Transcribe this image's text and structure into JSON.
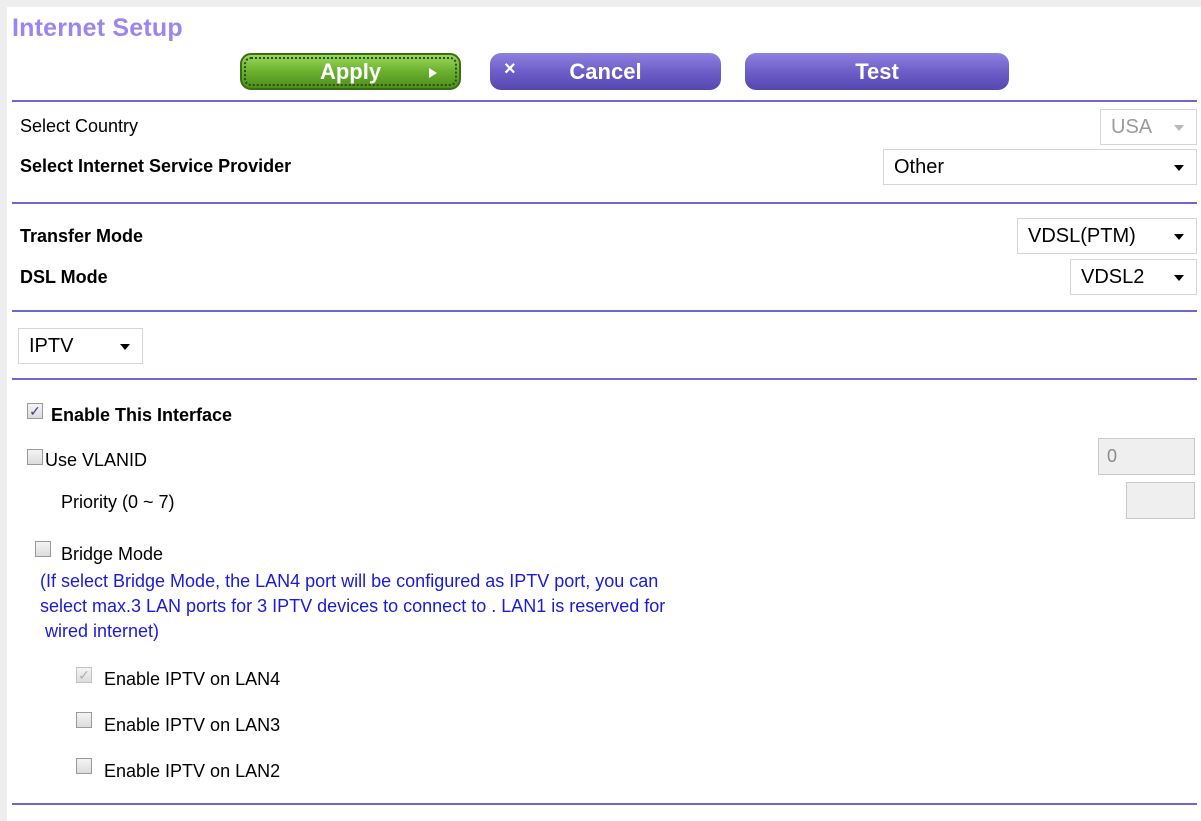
{
  "page": {
    "title": "Internet Setup"
  },
  "toolbar": {
    "apply_label": "Apply",
    "cancel_label": "Cancel",
    "cancel_icon": "×",
    "test_label": "Test"
  },
  "country": {
    "label": "Select Country",
    "value": "USA",
    "disabled": true
  },
  "isp": {
    "label": "Select Internet Service Provider",
    "value": "Other"
  },
  "transfer_mode": {
    "label": "Transfer Mode",
    "value": "VDSL(PTM)"
  },
  "dsl_mode": {
    "label": "DSL Mode",
    "value": "VDSL2"
  },
  "service": {
    "value": "IPTV"
  },
  "interface": {
    "enable_label": "Enable This Interface",
    "enable_checked": true,
    "enable_mark": "✓",
    "vlan_label": "Use VLANID",
    "vlan_checked": false,
    "vlan_value": "0",
    "priority_label": "Priority (0 ~ 7)",
    "priority_value": ""
  },
  "bridge": {
    "label": "Bridge Mode",
    "checked": false,
    "note_line1": "(If select Bridge Mode, the LAN4 port will be configured as IPTV port, you can",
    "note_line2": "select max.3 LAN ports for 3 IPTV devices to connect to . LAN1 is reserved for",
    "note_line3": " wired internet)",
    "lan4_label": "Enable IPTV on LAN4",
    "lan4_checked": true,
    "lan4_disabled": true,
    "lan4_mark": "✓",
    "lan3_label": "Enable IPTV on LAN3",
    "lan3_checked": false,
    "lan2_label": "Enable IPTV on LAN2",
    "lan2_checked": false
  },
  "colors": {
    "title": "#9b85ee",
    "accent": "#7065d4",
    "apply_green": "#6bb02e",
    "button_purple": "#6a5bc7",
    "note_blue": "#1a1adb"
  }
}
